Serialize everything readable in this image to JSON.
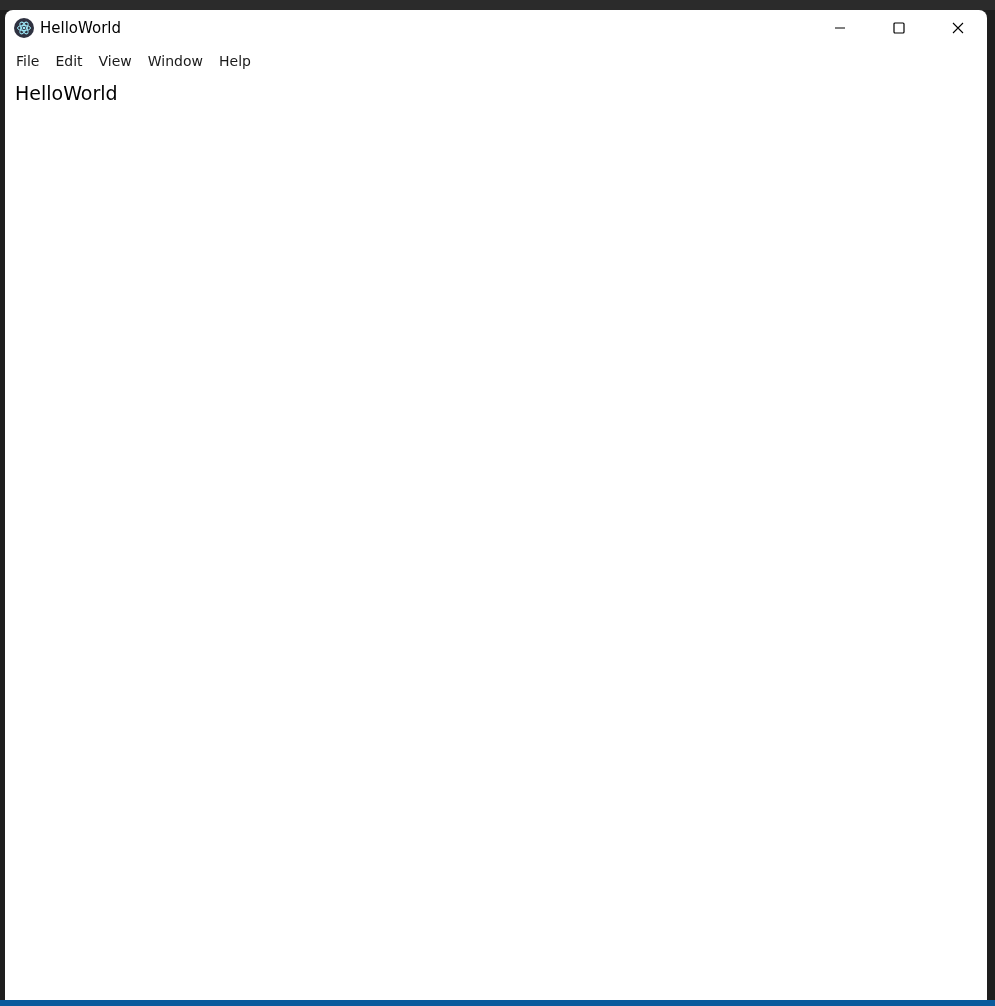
{
  "window": {
    "title": "HelloWorld"
  },
  "menu": [
    {
      "label": "File"
    },
    {
      "label": "Edit"
    },
    {
      "label": "View"
    },
    {
      "label": "Window"
    },
    {
      "label": "Help"
    }
  ],
  "content": {
    "heading": "HelloWorld"
  }
}
